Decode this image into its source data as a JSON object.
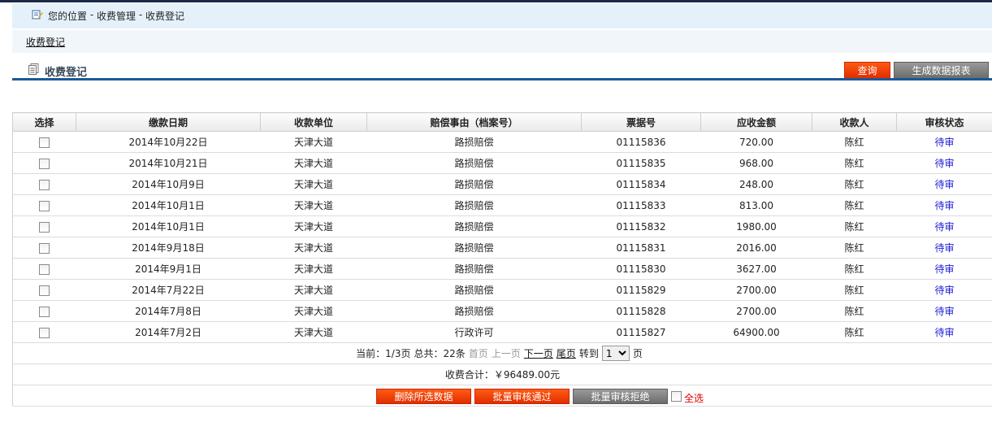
{
  "location": {
    "prefix": "您的位置",
    "sep": " - ",
    "crumbs": [
      "收费管理",
      "收费登记"
    ]
  },
  "subnav": {
    "link": "收费登记"
  },
  "page_title": "收费登记",
  "actions": {
    "query": "查询",
    "report": "生成数据报表"
  },
  "table": {
    "columns": [
      "选择",
      "缴款日期",
      "收款单位",
      "赔偿事由（档案号）",
      "票据号",
      "应收金额",
      "收款人",
      "审核状态"
    ],
    "rows": [
      {
        "date": "2014年10月22日",
        "unit": "天津大道",
        "reason": "路损赔偿",
        "ticket": "01115836",
        "amount": "720.00",
        "payee": "陈红",
        "status": "待审"
      },
      {
        "date": "2014年10月21日",
        "unit": "天津大道",
        "reason": "路损赔偿",
        "ticket": "01115835",
        "amount": "968.00",
        "payee": "陈红",
        "status": "待审"
      },
      {
        "date": "2014年10月9日",
        "unit": "天津大道",
        "reason": "路损赔偿",
        "ticket": "01115834",
        "amount": "248.00",
        "payee": "陈红",
        "status": "待审"
      },
      {
        "date": "2014年10月1日",
        "unit": "天津大道",
        "reason": "路损赔偿",
        "ticket": "01115833",
        "amount": "813.00",
        "payee": "陈红",
        "status": "待审"
      },
      {
        "date": "2014年10月1日",
        "unit": "天津大道",
        "reason": "路损赔偿",
        "ticket": "01115832",
        "amount": "1980.00",
        "payee": "陈红",
        "status": "待审"
      },
      {
        "date": "2014年9月18日",
        "unit": "天津大道",
        "reason": "路损赔偿",
        "ticket": "01115831",
        "amount": "2016.00",
        "payee": "陈红",
        "status": "待审"
      },
      {
        "date": "2014年9月1日",
        "unit": "天津大道",
        "reason": "路损赔偿",
        "ticket": "01115830",
        "amount": "3627.00",
        "payee": "陈红",
        "status": "待审"
      },
      {
        "date": "2014年7月22日",
        "unit": "天津大道",
        "reason": "路损赔偿",
        "ticket": "01115829",
        "amount": "2700.00",
        "payee": "陈红",
        "status": "待审"
      },
      {
        "date": "2014年7月8日",
        "unit": "天津大道",
        "reason": "路损赔偿",
        "ticket": "01115828",
        "amount": "2700.00",
        "payee": "陈红",
        "status": "待审"
      },
      {
        "date": "2014年7月2日",
        "unit": "天津大道",
        "reason": "行政许可",
        "ticket": "01115827",
        "amount": "64900.00",
        "payee": "陈红",
        "status": "待审"
      }
    ]
  },
  "pager": {
    "current": "当前：1/3页",
    "total": "总共：22条",
    "first": "首页",
    "prev": "上一页",
    "next": "下一页",
    "last": "尾页",
    "goto": "转到",
    "page_value": "1",
    "page_suffix": "页"
  },
  "summary": {
    "label": "收费合计：￥96489.00元"
  },
  "bulk": {
    "delete": "删除所选数据",
    "approve": "批量审核通过",
    "reject": "批量审核拒绝",
    "select_all": "全选"
  },
  "colors": {
    "accent_red": "#e12d00",
    "rule_blue": "#1b5a98",
    "link_blue": "#1a1ad6",
    "amount_red": "#e00000"
  },
  "icons": {
    "location": "edit-note-icon",
    "title": "document-icon"
  }
}
